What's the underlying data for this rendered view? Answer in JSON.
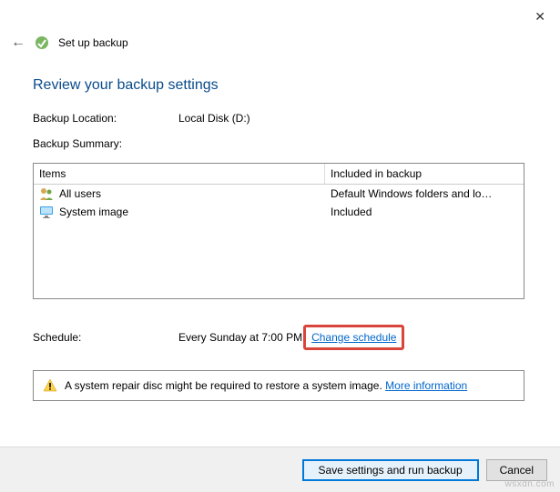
{
  "window": {
    "title": "Set up backup"
  },
  "page": {
    "heading": "Review your backup settings"
  },
  "backup_location": {
    "label": "Backup Location:",
    "value": "Local Disk (D:)"
  },
  "backup_summary": {
    "label": "Backup Summary:",
    "columns": {
      "items": "Items",
      "included": "Included in backup"
    },
    "rows": [
      {
        "icon": "users-icon",
        "name": "All users",
        "included": "Default Windows folders and lo…"
      },
      {
        "icon": "monitor-icon",
        "name": "System image",
        "included": "Included"
      }
    ]
  },
  "schedule": {
    "label": "Schedule:",
    "value": "Every Sunday at 7:00 PM",
    "change_link": "Change schedule"
  },
  "warning": {
    "text": "A system repair disc might be required to restore a system image.",
    "more_link": "More information"
  },
  "footer": {
    "primary": "Save settings and run backup",
    "cancel": "Cancel"
  },
  "watermark": "wsxdn.com"
}
